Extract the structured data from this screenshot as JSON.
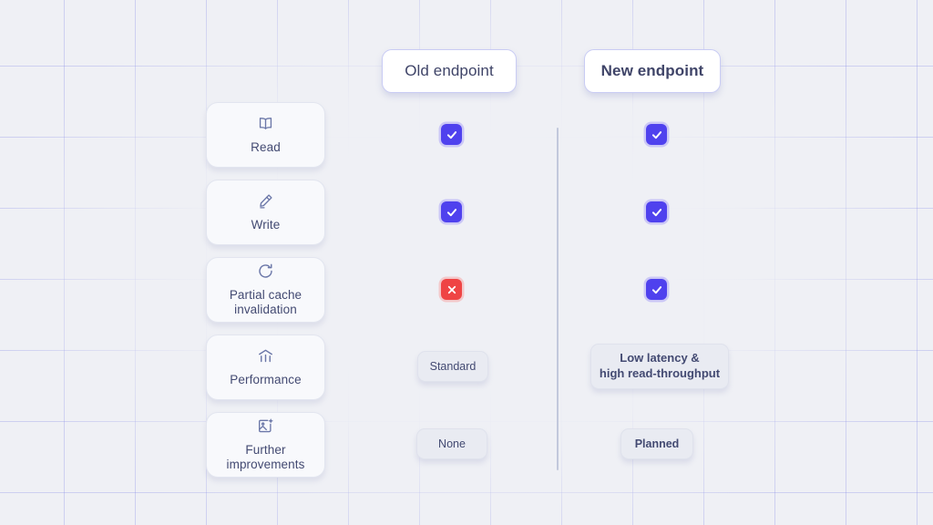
{
  "page": {
    "title": "Old endpoint vs New endpoint capability comparison",
    "background_color": "#eff0f5",
    "grid_line_color": "#7e82e6",
    "accent_color": "#4f41ee",
    "negative_color": "#ef4444",
    "text_color": "#434a72"
  },
  "columns": {
    "old": {
      "label": "Old endpoint"
    },
    "new": {
      "label": "New endpoint"
    }
  },
  "features": [
    {
      "label": "Read",
      "icon": "book-icon"
    },
    {
      "label": "Write",
      "icon": "pencil-icon"
    },
    {
      "label": "Partial cache\ninvalidation",
      "line1": "Partial cache",
      "line2": "invalidation",
      "icon": "refresh-icon"
    },
    {
      "label": "Performance",
      "icon": "bar-chart-icon"
    },
    {
      "label": "Further\nimprovements",
      "line1": "Further",
      "line2": "improvements",
      "icon": "image-sparkle-icon"
    }
  ],
  "matrix": {
    "read": {
      "old": {
        "type": "check",
        "symbol": "✓"
      },
      "new": {
        "type": "check",
        "symbol": "✓"
      }
    },
    "write": {
      "old": {
        "type": "check",
        "symbol": "✓"
      },
      "new": {
        "type": "check",
        "symbol": "✓"
      }
    },
    "cache": {
      "old": {
        "type": "cross",
        "symbol": "✕"
      },
      "new": {
        "type": "check",
        "symbol": "✓"
      }
    },
    "performance": {
      "old": {
        "type": "value",
        "text": "Standard"
      },
      "new": {
        "type": "value",
        "line1": "Low latency &",
        "line2": "high read-throughput"
      }
    },
    "improvements": {
      "old": {
        "type": "value",
        "text": "None"
      },
      "new": {
        "type": "value",
        "text": "Planned"
      }
    }
  }
}
